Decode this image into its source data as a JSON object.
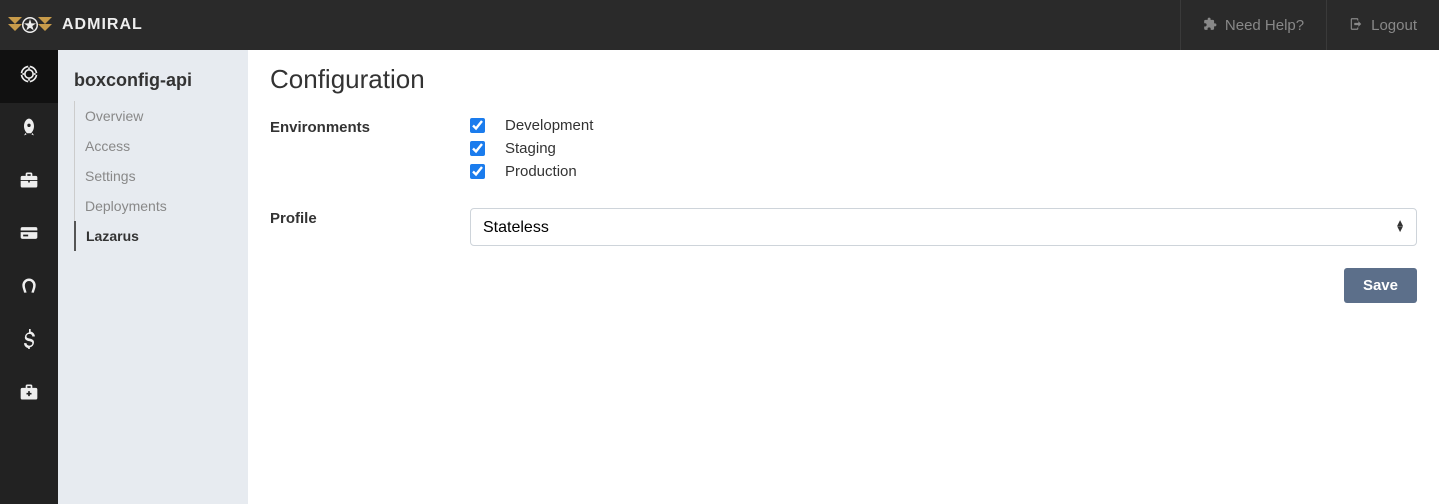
{
  "topbar": {
    "brand": "ADMIRAL",
    "help_label": "Need Help?",
    "logout_label": "Logout"
  },
  "iconbar": {
    "items": [
      {
        "name": "target-icon"
      },
      {
        "name": "rocket-icon"
      },
      {
        "name": "briefcase-icon"
      },
      {
        "name": "card-icon"
      },
      {
        "name": "horseshoe-icon"
      },
      {
        "name": "dollar-icon"
      },
      {
        "name": "medkit-icon"
      }
    ]
  },
  "sidebar": {
    "title": "boxconfig-api",
    "items": [
      {
        "label": "Overview",
        "active": false
      },
      {
        "label": "Access",
        "active": false
      },
      {
        "label": "Settings",
        "active": false
      },
      {
        "label": "Deployments",
        "active": false
      },
      {
        "label": "Lazarus",
        "active": true
      }
    ]
  },
  "main": {
    "title": "Configuration",
    "labels": {
      "environments": "Environments",
      "profile": "Profile"
    },
    "environments": [
      {
        "label": "Development",
        "checked": true
      },
      {
        "label": "Staging",
        "checked": true
      },
      {
        "label": "Production",
        "checked": true
      }
    ],
    "profile": {
      "options": [
        "Stateless"
      ],
      "selected": "Stateless"
    },
    "save_label": "Save"
  }
}
